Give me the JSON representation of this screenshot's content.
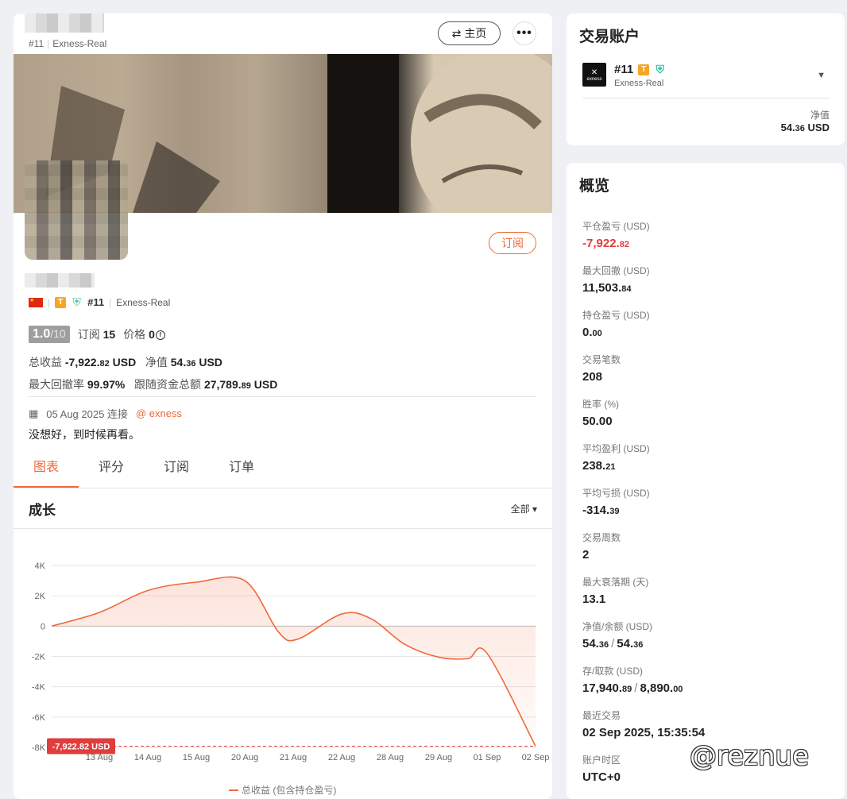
{
  "profile": {
    "account_id": "#11",
    "server": "Exness-Real",
    "home_label": "主页",
    "more_label": "•••",
    "subscribe_label": "订阅",
    "rating": "1.0",
    "rating_max": "/10",
    "subscribe_count_label": "订阅",
    "subscribe_count": "15",
    "price_label": "价格",
    "price_value": "0",
    "total_profit_label": "总收益",
    "total_profit_main": "-7,922.",
    "total_profit_dec": "82",
    "total_profit_unit": "USD",
    "equity_label": "净值",
    "equity_main": "54.",
    "equity_dec": "36",
    "equity_unit": "USD",
    "max_dd_label": "最大回撤率",
    "max_dd_value": "99.97%",
    "follow_funds_label": "跟随资金总额",
    "follow_funds_main": "27,789.",
    "follow_funds_dec": "89",
    "follow_funds_unit": "USD",
    "connected_date": "05 Aug 2025 连接",
    "broker_link": "@ exness",
    "bio": "没想好，到时候再看。"
  },
  "tabs": [
    {
      "label": "图表",
      "active": true
    },
    {
      "label": "评分",
      "active": false
    },
    {
      "label": "订阅",
      "active": false
    },
    {
      "label": "订单",
      "active": false
    }
  ],
  "chart": {
    "title": "成长",
    "range_label": "全部",
    "current_label": "-7,922.82 USD",
    "legend": "总收益 (包含持仓盈亏)"
  },
  "chart_data": {
    "type": "area",
    "title": "成长",
    "y_ticks": [
      "4K",
      "2K",
      "0",
      "-2K",
      "-4K",
      "-6K",
      "-8K"
    ],
    "ylim": [
      -8000,
      4000
    ],
    "x_ticks": [
      "13 Aug",
      "14 Aug",
      "15 Aug",
      "20 Aug",
      "21 Aug",
      "22 Aug",
      "28 Aug",
      "29 Aug",
      "01 Sep",
      "02 Sep"
    ],
    "series": [
      {
        "name": "总收益 (包含持仓盈亏)",
        "color": "#f0683a",
        "points": [
          {
            "i": -1,
            "y": 0
          },
          {
            "i": 0.0,
            "y": 900
          },
          {
            "i": 1.0,
            "y": 2350
          },
          {
            "i": 2.0,
            "y": 2900
          },
          {
            "i": 3.0,
            "y": 3000
          },
          {
            "i": 3.7,
            "y": -400
          },
          {
            "i": 4.1,
            "y": -850
          },
          {
            "i": 5.0,
            "y": 800
          },
          {
            "i": 5.6,
            "y": 500
          },
          {
            "i": 6.3,
            "y": -1200
          },
          {
            "i": 7.0,
            "y": -2050
          },
          {
            "i": 7.6,
            "y": -2150
          },
          {
            "i": 8.0,
            "y": -1800
          },
          {
            "i": 9.0,
            "y": -7922.82
          }
        ]
      }
    ],
    "grid": true
  },
  "account_card": {
    "title": "交易账户",
    "account_id": "#11",
    "server": "Exness-Real",
    "logo_text": "exness",
    "equity_label": "净值",
    "equity_main": "54.",
    "equity_dec": "36",
    "equity_unit": "USD"
  },
  "overview": {
    "title": "概览",
    "items": [
      {
        "label": "平仓盈亏 (USD)",
        "main": "-7,922.",
        "dec": "82",
        "neg": true
      },
      {
        "label": "最大回撤 (USD)",
        "main": "11,503.",
        "dec": "84"
      },
      {
        "label": "持仓盈亏 (USD)",
        "main": "0.",
        "dec": "00"
      },
      {
        "label": "交易笔数",
        "main": "208",
        "dec": ""
      },
      {
        "label": "胜率 (%)",
        "main": "50.00",
        "dec": ""
      },
      {
        "label": "平均盈利 (USD)",
        "main": "238.",
        "dec": "21"
      },
      {
        "label": "平均亏损 (USD)",
        "main": "-314.",
        "dec": "39"
      },
      {
        "label": "交易周数",
        "main": "2",
        "dec": ""
      },
      {
        "label": "最大衰落期 (天)",
        "main": "13.1",
        "dec": ""
      },
      {
        "label": "净值/余额 (USD)",
        "main": "54.",
        "dec": "36",
        "main2": "54.",
        "dec2": "36"
      },
      {
        "label": "存/取款 (USD)",
        "main": "17,940.",
        "dec": "89",
        "main2": "8,890.",
        "dec2": "00"
      },
      {
        "label": "最近交易",
        "main": "02 Sep 2025, 15:35:54",
        "dec": ""
      },
      {
        "label": "账户时区",
        "main": "UTC+0",
        "dec": ""
      }
    ]
  },
  "watermark": "@reznue"
}
